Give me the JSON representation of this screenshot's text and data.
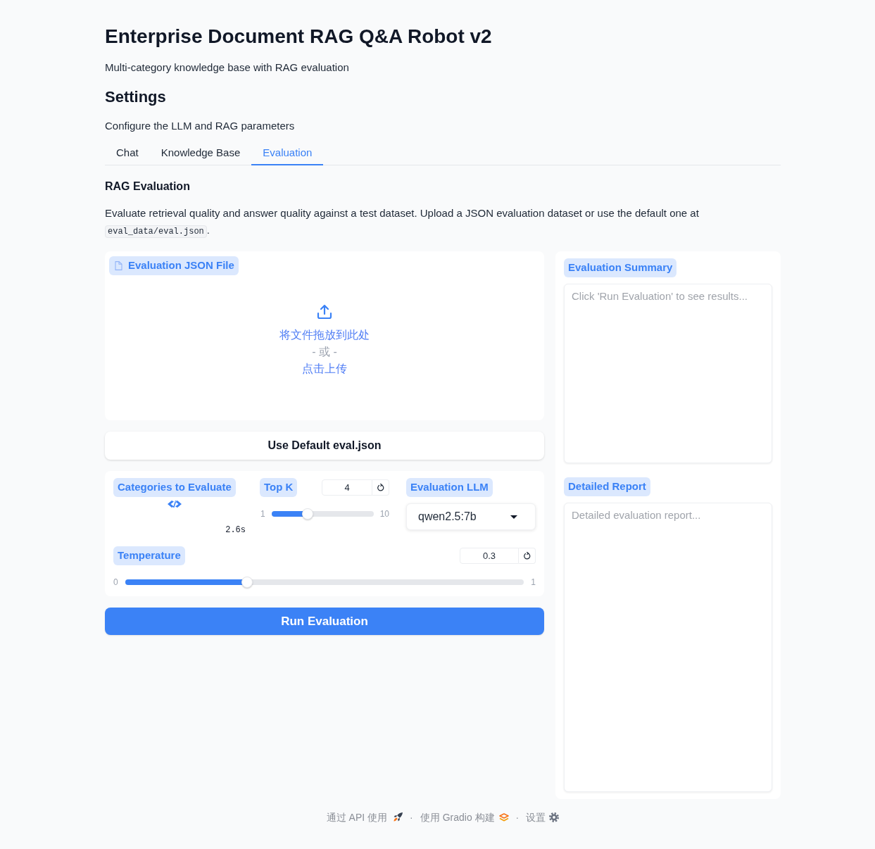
{
  "header": {
    "title": "Enterprise Document RAG Q&A Robot v2",
    "subtitle": "Multi-category knowledge base with RAG evaluation"
  },
  "settings": {
    "heading": "Settings",
    "description": "Configure the LLM and RAG parameters"
  },
  "tabs": [
    {
      "label": "Chat",
      "selected": false
    },
    {
      "label": "Knowledge Base",
      "selected": false
    },
    {
      "label": "Evaluation",
      "selected": true
    }
  ],
  "evaluation": {
    "heading": "RAG Evaluation",
    "description": {
      "text": "Evaluate retrieval quality and answer quality against a test dataset. Upload a JSON evaluation dataset or use the default one at",
      "code": "eval_data/eval.json",
      "after": "."
    },
    "upload": {
      "label": "Evaluation JSON File",
      "drop_text": "将文件拖放到此处",
      "or_text": "- 或 -",
      "click_text": "点击上传"
    },
    "default_button": "Use Default eval.json",
    "categories": {
      "label": "Categories to Evaluate",
      "loading": true,
      "timer": "2.6s"
    },
    "top_k": {
      "label": "Top K",
      "value": "4",
      "min": "1",
      "max": "10",
      "level": 0.333
    },
    "llm": {
      "label": "Evaluation LLM",
      "value": "qwen2.5:7b"
    },
    "temperature": {
      "label": "Temperature",
      "value": "0.3",
      "min": "0",
      "max": "1",
      "level": 0.3
    },
    "run_button": "Run Evaluation",
    "summary": {
      "label": "Evaluation Summary",
      "placeholder": "Click 'Run Evaluation' to see results..."
    },
    "report": {
      "label": "Detailed Report",
      "placeholder": "Detailed evaluation report..."
    }
  },
  "footer": [
    {
      "kind": "api",
      "label": "通过 API 使用"
    },
    {
      "kind": "separator",
      "label": "·"
    },
    {
      "kind": "gradio",
      "label": "使用 Gradio 构建"
    },
    {
      "kind": "separator",
      "label": "·"
    },
    {
      "kind": "settings",
      "label": "设置"
    }
  ]
}
